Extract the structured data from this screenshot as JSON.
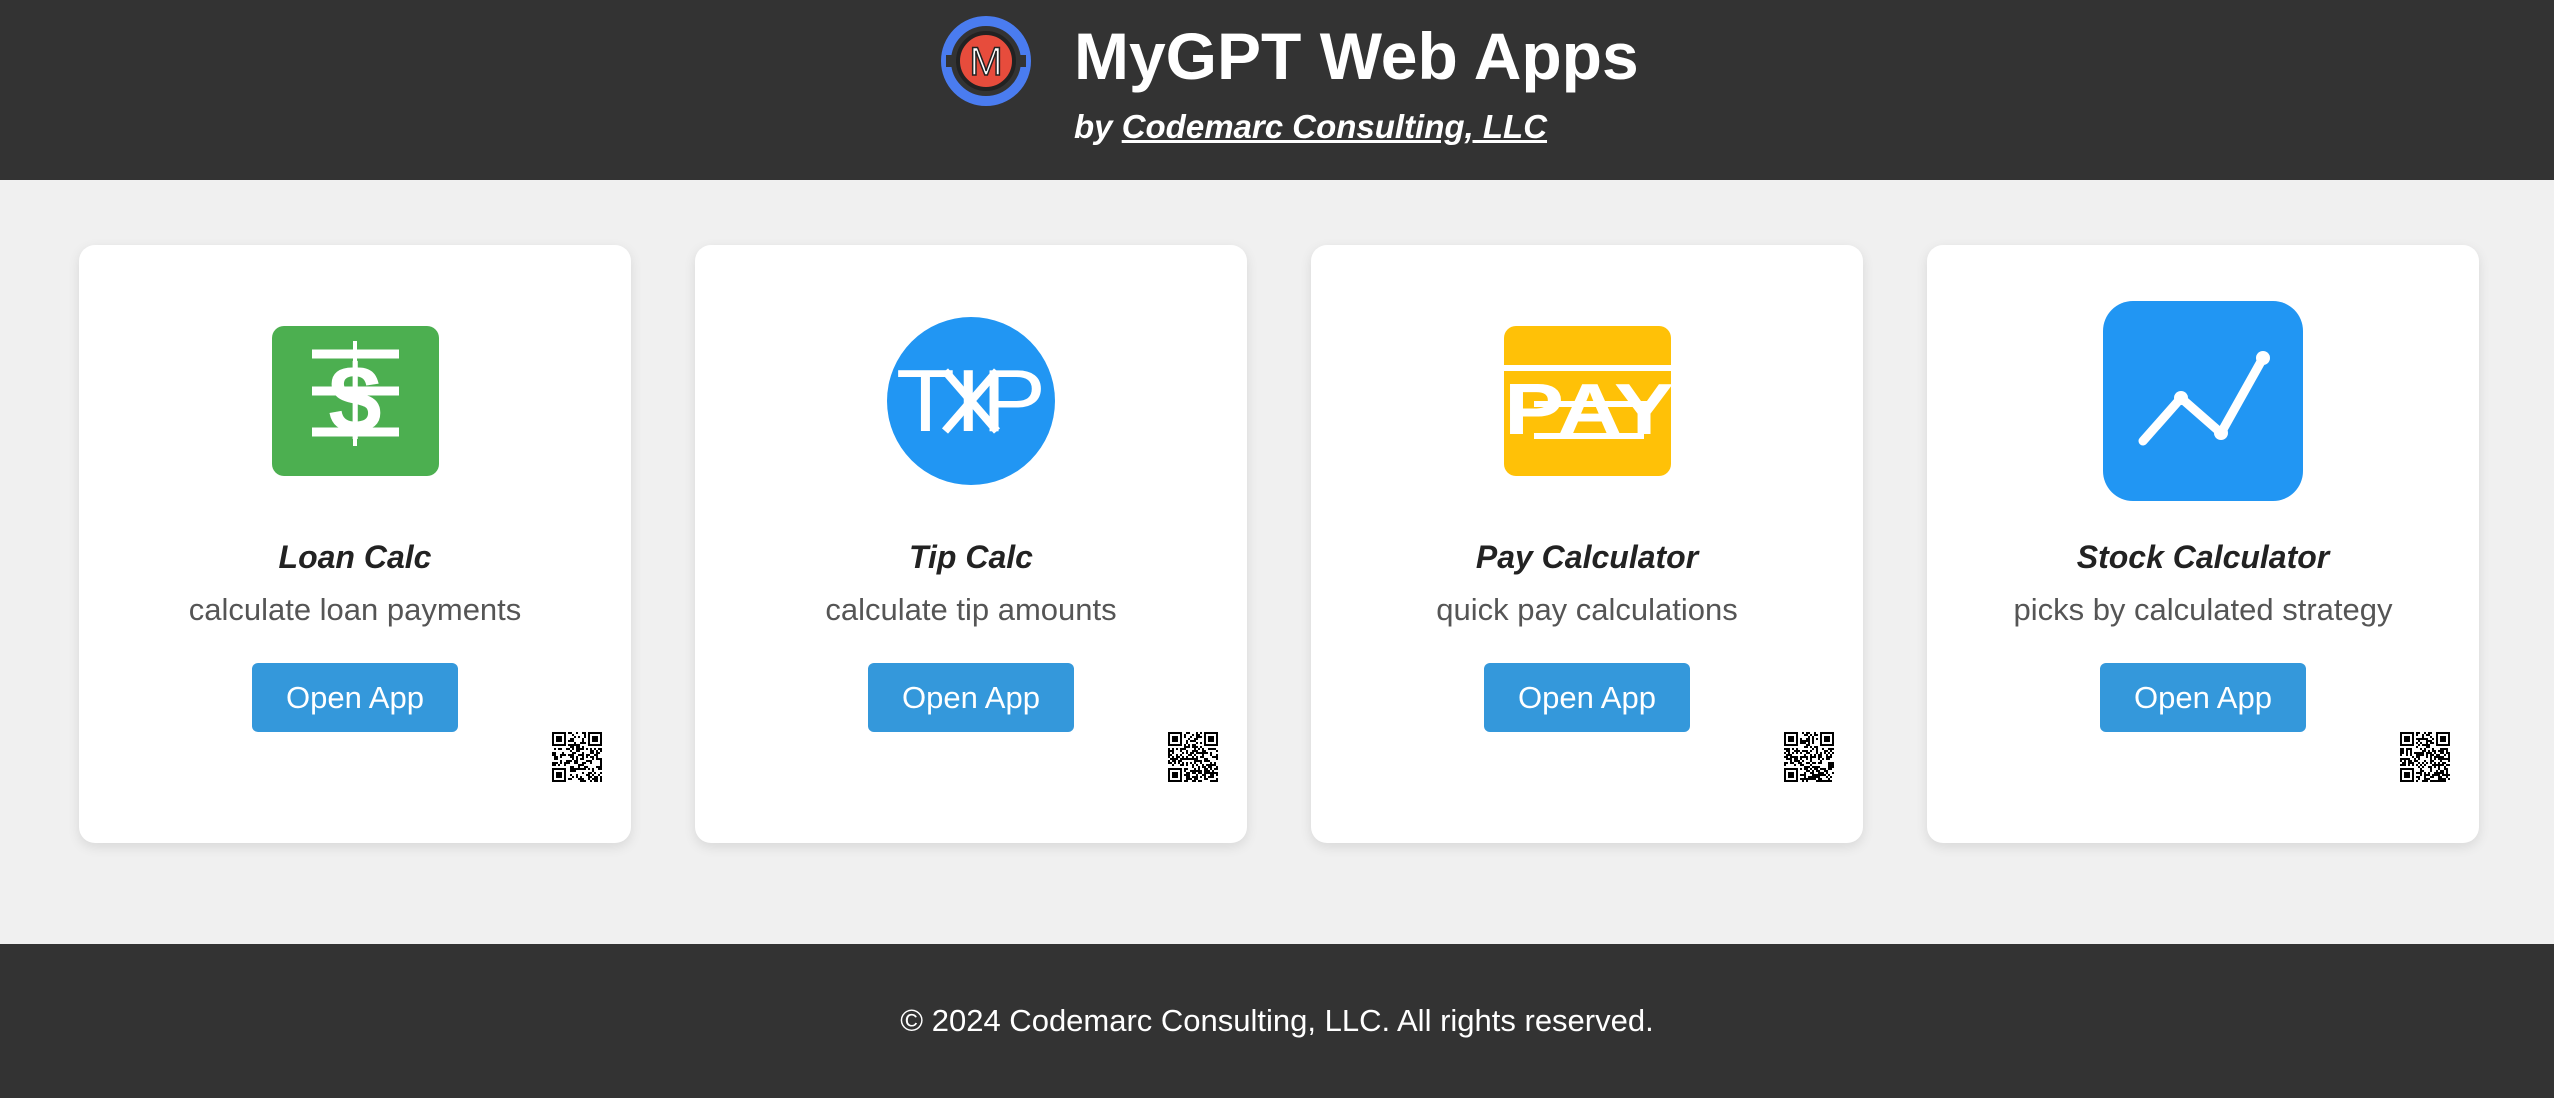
{
  "header": {
    "logo_letter": "M",
    "title": "MyGPT Web Apps",
    "byline_prefix": "by",
    "byline_link": "Codemarc Consulting, LLC"
  },
  "apps": [
    {
      "name": "Loan Calc",
      "description": "calculate loan payments",
      "button": "Open App",
      "icon": "dollar-sign-icon",
      "icon_text": "$",
      "color": "#4caf50"
    },
    {
      "name": "Tip Calc",
      "description": "calculate tip amounts",
      "button": "Open App",
      "icon": "tip-icon",
      "icon_text": "TIP",
      "color": "#2196f3"
    },
    {
      "name": "Pay Calculator",
      "description": "quick pay calculations",
      "button": "Open App",
      "icon": "pay-icon",
      "icon_text": "PAY",
      "color": "#ffc107"
    },
    {
      "name": "Stock Calculator",
      "description": "picks by calculated strategy",
      "button": "Open App",
      "icon": "stock-chart-icon",
      "color": "#2196f3"
    }
  ],
  "footer": {
    "copyright": "© 2024 Codemarc Consulting, LLC. All rights reserved."
  },
  "colors": {
    "header_bg": "#333333",
    "page_bg": "#f0f0f0",
    "button_bg": "#3498db",
    "logo_ring": "#4a7cf0",
    "logo_center": "#e74c3c"
  }
}
